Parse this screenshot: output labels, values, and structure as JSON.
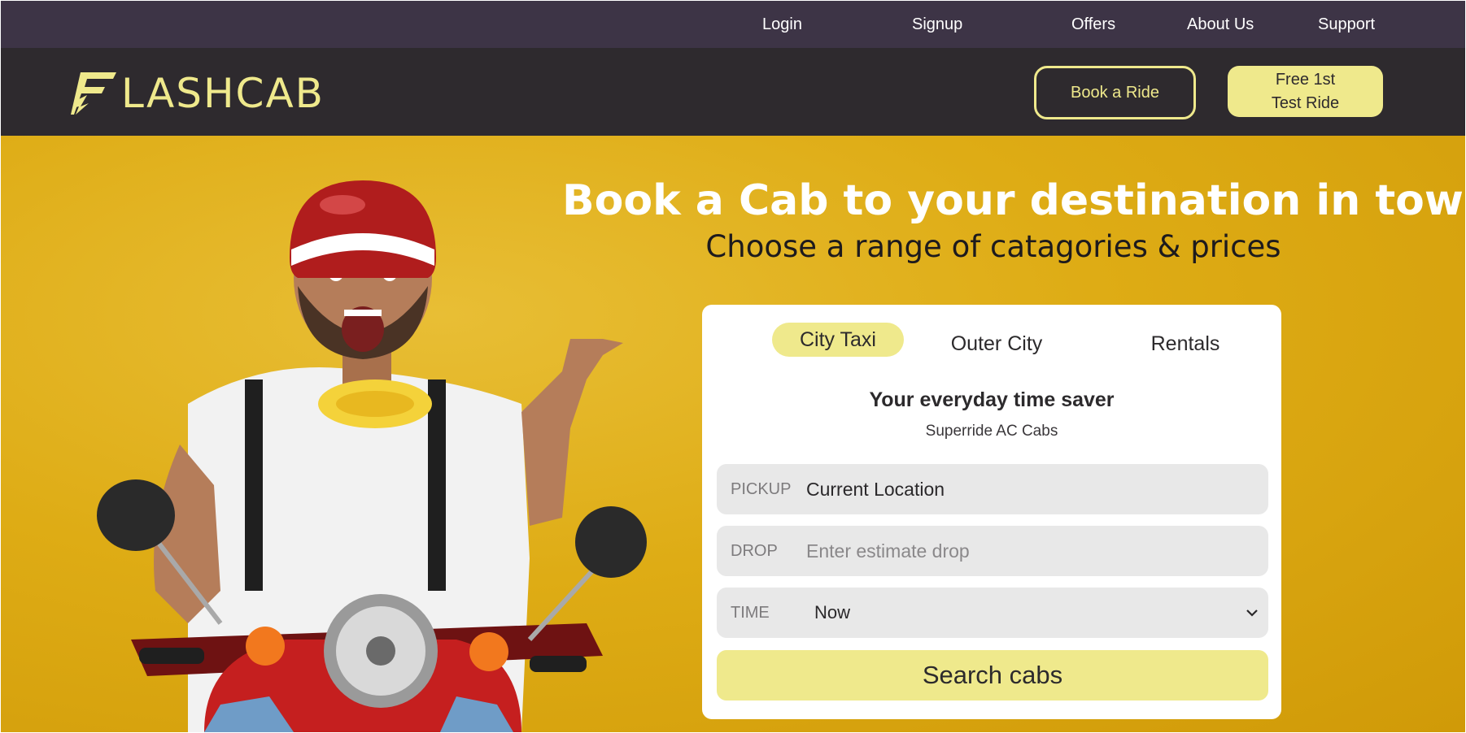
{
  "top_links": {
    "login": "Login",
    "signup": "Signup",
    "offers": "Offers",
    "about": "About Us",
    "support": "Support"
  },
  "brand": {
    "logo_text": "LASHCAB",
    "logo_icon": "lightning-f-icon",
    "accent_color": "#efe98c"
  },
  "nav_buttons": {
    "book_ride": "Book a Ride",
    "free_test_ride_line1": "Free 1st",
    "free_test_ride_line2": "Test Ride"
  },
  "hero": {
    "headline": "Book a Cab to your destination in town",
    "subheadline": "Choose a range of catagories & prices"
  },
  "booking": {
    "tabs": [
      "City Taxi",
      "Outer City",
      "Rentals"
    ],
    "active_tab": "City Taxi",
    "title": "Your everyday time saver",
    "subtitle": "Superride AC Cabs",
    "pickup": {
      "label": "PICKUP",
      "value": "Current Location"
    },
    "drop": {
      "label": "DROP",
      "placeholder": "Enter estimate drop"
    },
    "time": {
      "label": "TIME",
      "value": "Now"
    },
    "search_label": "Search cabs"
  }
}
